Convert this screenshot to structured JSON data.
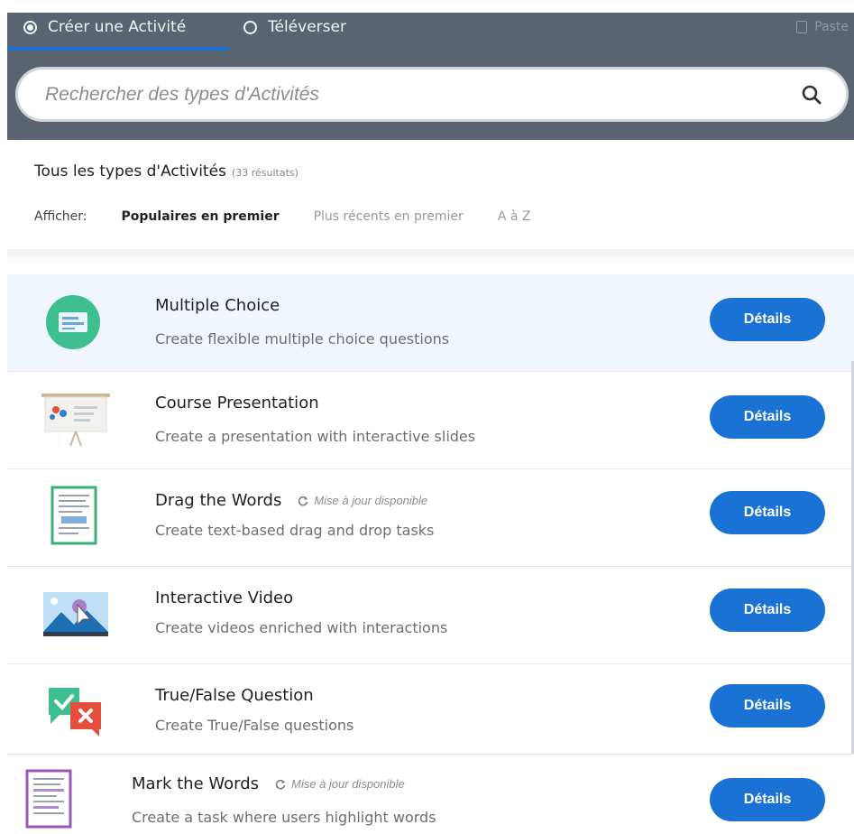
{
  "tabs": {
    "create": "Créer une Activité",
    "upload": "Téléverser",
    "paste": "Paste"
  },
  "search": {
    "placeholder": "Rechercher des types d'Activités"
  },
  "list": {
    "heading": "Tous les types d'Activités",
    "count": "(33 résultats)",
    "sort_label": "Afficher:",
    "sort_options": [
      "Populaires en premier",
      "Plus récents en premier",
      "A à Z"
    ]
  },
  "items": [
    {
      "title": "Multiple Choice",
      "desc": "Create flexible multiple choice questions",
      "button": "Détails",
      "update": ""
    },
    {
      "title": "Course Presentation",
      "desc": "Create a presentation with interactive slides",
      "button": "Détails",
      "update": ""
    },
    {
      "title": "Drag the Words",
      "desc": "Create text-based drag and drop tasks",
      "button": "Détails",
      "update": "Mise à jour disponible"
    },
    {
      "title": "Interactive Video",
      "desc": "Create videos enriched with interactions",
      "button": "Détails",
      "update": ""
    },
    {
      "title": "True/False Question",
      "desc": "Create True/False questions",
      "button": "Détails",
      "update": ""
    },
    {
      "title": "Mark the Words",
      "desc": "Create a task where users highlight words",
      "button": "Détails",
      "update": "Mise à jour disponible"
    }
  ],
  "colors": {
    "accent": "#1a73d4",
    "header": "#5a6470",
    "highlight": "#f0f6fb"
  }
}
